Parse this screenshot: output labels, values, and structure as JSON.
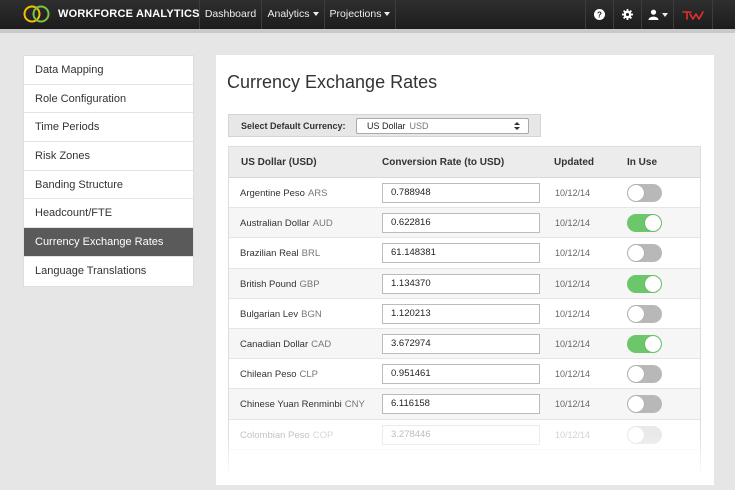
{
  "navbar": {
    "brand": "WORKFORCE ANALYTICS",
    "items": [
      {
        "label": "Dashboard",
        "dropdown": false
      },
      {
        "label": "Analytics",
        "dropdown": true
      },
      {
        "label": "Projections",
        "dropdown": true
      }
    ],
    "icons": [
      "help-icon",
      "gear-icon",
      "user-icon",
      "tw-logo-icon"
    ]
  },
  "sidebar": {
    "items": [
      {
        "label": "Data Mapping",
        "active": false
      },
      {
        "label": "Role Configuration",
        "active": false
      },
      {
        "label": "Time Periods",
        "active": false
      },
      {
        "label": "Risk Zones",
        "active": false
      },
      {
        "label": "Banding Structure",
        "active": false
      },
      {
        "label": "Headcount/FTE",
        "active": false
      },
      {
        "label": "Currency Exchange Rates",
        "active": true
      },
      {
        "label": "Language Translations",
        "active": false
      }
    ]
  },
  "main": {
    "title": "Currency Exchange Rates",
    "default_currency": {
      "label": "Select Default Currency:",
      "selected_name": "US Dollar",
      "selected_code": "USD"
    },
    "table": {
      "headers": [
        "US Dollar (USD)",
        "Conversion Rate (to USD)",
        "Updated",
        "In Use"
      ],
      "rows": [
        {
          "name": "Argentine Peso",
          "code": "ARS",
          "rate": "0.788948",
          "updated": "10/12/14",
          "in_use": false
        },
        {
          "name": "Australian Dollar",
          "code": "AUD",
          "rate": "0.622816",
          "updated": "10/12/14",
          "in_use": true
        },
        {
          "name": "Brazilian Real",
          "code": "BRL",
          "rate": "61.148381",
          "updated": "10/12/14",
          "in_use": false
        },
        {
          "name": "British Pound",
          "code": "GBP",
          "rate": "1.134370",
          "updated": "10/12/14",
          "in_use": true
        },
        {
          "name": "Bulgarian Lev",
          "code": "BGN",
          "rate": "1.120213",
          "updated": "10/12/14",
          "in_use": false
        },
        {
          "name": "Canadian Dollar",
          "code": "CAD",
          "rate": "3.672974",
          "updated": "10/12/14",
          "in_use": true
        },
        {
          "name": "Chilean Peso",
          "code": "CLP",
          "rate": "0.951461",
          "updated": "10/12/14",
          "in_use": false
        },
        {
          "name": "Chinese Yuan Renminbi",
          "code": "CNY",
          "rate": "6.116158",
          "updated": "10/12/14",
          "in_use": false
        },
        {
          "name": "Colombian Peso",
          "code": "COP",
          "rate": "3.278446",
          "updated": "10/12/14",
          "in_use": false
        }
      ]
    }
  },
  "colors": {
    "navbar": "#1c1c1c",
    "active_sidebar": "#5a5a5a",
    "toggle_on": "#6cc66a",
    "toggle_off": "#b8b8b8",
    "brand_red": "#e0312f"
  }
}
